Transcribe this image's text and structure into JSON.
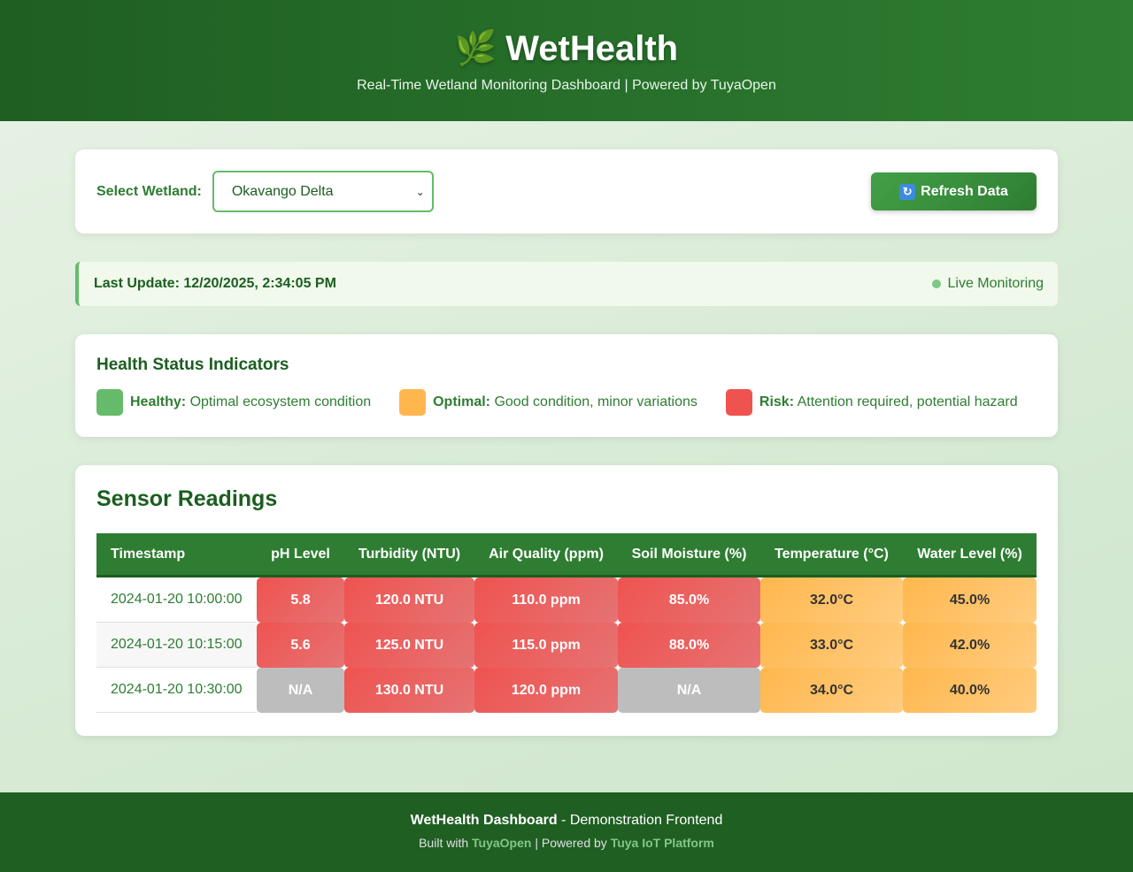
{
  "header": {
    "icon": "🌿",
    "title": "WetHealth",
    "subtitle": "Real-Time Wetland Monitoring Dashboard | Powered by TuyaOpen"
  },
  "selector": {
    "label": "Select Wetland:",
    "selected": "Okavango Delta",
    "refresh_label": "Refresh Data",
    "refresh_icon": "🔄"
  },
  "status": {
    "last_update": "Last Update: 12/20/2025, 2:34:05 PM",
    "live_label": "Live Monitoring"
  },
  "legend": {
    "title": "Health Status Indicators",
    "items": [
      {
        "name": "Healthy:",
        "desc": "Optimal ecosystem condition",
        "color": "#66bb6a"
      },
      {
        "name": "Optimal:",
        "desc": "Good condition, minor variations",
        "color": "#ffb74d"
      },
      {
        "name": "Risk:",
        "desc": "Attention required, potential hazard",
        "color": "#ef5350"
      }
    ]
  },
  "sensors": {
    "title": "Sensor Readings",
    "columns": [
      "Timestamp",
      "pH Level",
      "Turbidity (NTU)",
      "Air Quality (ppm)",
      "Soil Moisture (%)",
      "Temperature (°C)",
      "Water Level (%)"
    ],
    "rows": [
      {
        "cells": [
          "2024-01-20 10:00:00",
          "5.8",
          "120.0 NTU",
          "110.0 ppm",
          "85.0%",
          "32.0°C",
          "45.0%"
        ],
        "status": [
          "ts",
          "risk",
          "risk",
          "risk",
          "risk",
          "warn",
          "warn"
        ]
      },
      {
        "cells": [
          "2024-01-20 10:15:00",
          "5.6",
          "125.0 NTU",
          "115.0 ppm",
          "88.0%",
          "33.0°C",
          "42.0%"
        ],
        "status": [
          "ts",
          "risk",
          "risk",
          "risk",
          "risk",
          "warn",
          "warn"
        ]
      },
      {
        "cells": [
          "2024-01-20 10:30:00",
          "N/A",
          "130.0 NTU",
          "120.0 ppm",
          "N/A",
          "34.0°C",
          "40.0%"
        ],
        "status": [
          "ts",
          "na",
          "risk",
          "risk",
          "na",
          "warn",
          "warn"
        ]
      }
    ]
  },
  "footer": {
    "brand": "WetHealth Dashboard",
    "tagline": " - Demonstration Frontend",
    "built_with": "Built with ",
    "link1": "TuyaOpen",
    "sep": " | Powered by ",
    "link2": "Tuya IoT Platform"
  }
}
